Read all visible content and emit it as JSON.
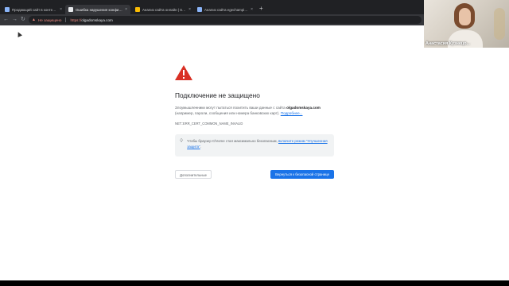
{
  "browser": {
    "tabs": [
      {
        "title": "Продающий сайт в контекс-н...",
        "favicon_color": "#8ab4f8",
        "active": false
      },
      {
        "title": "Ошибка нарушения конфиденц...",
        "favicon_color": "#e8eaed",
        "active": true
      },
      {
        "title": "Анализ сайта онлайн | SEO-ауд...",
        "favicon_color": "#fbbc04",
        "active": false
      },
      {
        "title": "Анализ сайта egechampion.ru",
        "favicon_color": "#8ab4f8",
        "active": false
      }
    ],
    "tab_close_glyph": "×",
    "new_tab_glyph": "+",
    "back_glyph": "←",
    "forward_glyph": "→",
    "reload_glyph": "↻",
    "url": {
      "warning_icon": "warning-triangle-icon",
      "security_label": "Не защищено",
      "protocol": "https://",
      "host": "olgadomskaya.com"
    }
  },
  "interstitial": {
    "title": "Подключение не защищено",
    "description_before": "Злоумышленники могут пытаться похитить ваши данные с сайта ",
    "domain": "olgadomskaya.com",
    "description_after": " (например, пароли, сообщения или номера банковских карт). ",
    "learn_more": "Подробнее...",
    "error_code": "NET::ERR_CERT_COMMON_NAME_INVALID",
    "note_text": "Чтобы браузер Chrome стал максимально безопасным, ",
    "note_link": "включите режим \"Улучшенная защита\"",
    "note_end": ".",
    "advanced_button": "Дополнительные",
    "back_button": "Вернуться к безопасной странице",
    "warning_color": "#d93025",
    "accent_color": "#1a73e8"
  },
  "webcam": {
    "participant_name": "Анастасия Кузнецо..."
  }
}
